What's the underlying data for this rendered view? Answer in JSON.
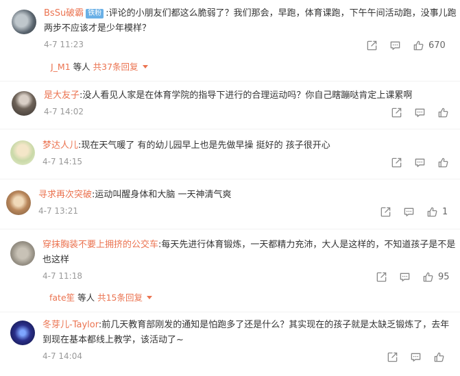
{
  "comments": [
    {
      "user": "BsSu破霸",
      "badge": "铁粉",
      "text_line1": ":评论的小朋友们都这么脆弱了？我们那会，早跑，体育课跑，下午午间活动跑，没事儿跑",
      "text_line2": "两步不应该才是少年模样？",
      "time": "4-7 11:23",
      "likes": "670",
      "replies": {
        "name": "J_M1",
        "mid": " 等人 ",
        "count": "共37条回复"
      }
    },
    {
      "user": "是大友子",
      "text_line1": ":没人看见人家是在体育学院的指导下进行的合理运动吗？你自己瞎蹦哒肯定上课累啊",
      "time": "4-7 14:02"
    },
    {
      "user": "梦达人儿",
      "text_line1": ":现在天气暖了 有的幼儿园早上也是先做早操 挺好的 孩子很开心",
      "time": "4-7 14:15"
    },
    {
      "user": "寻求再次突破",
      "text_line1": ":运动叫醒身体和大脑 一天神清气爽",
      "time": "4-7 13:21",
      "likes": "1"
    },
    {
      "user": "穿抹胸装不要上拥挤的公交车",
      "text_line1": ":每天先进行体育锻炼，一天都精力充沛，大人是这样的，不知道孩子是不是",
      "text_line2": "也这样",
      "time": "4-7 11:18",
      "likes": "95",
      "replies": {
        "name": "fate笙",
        "mid": " 等人 ",
        "count": "共15条回复"
      }
    },
    {
      "user": "冬芽儿-Taylor",
      "text_line1": ":前几天教育部刚发的通知是怕跑多了还是什么？其实现在的孩子就是太缺乏锻炼了，去年",
      "text_line2": "到现在基本都线上教学，该活动了~",
      "time": "4-7 14:04"
    }
  ],
  "icons": {
    "share": "share-icon",
    "comment": "comment-icon",
    "like": "thumbs-up-icon"
  },
  "colors": {
    "username": "#eb7350",
    "badge": "#6ab0e6",
    "meta": "#999999"
  }
}
